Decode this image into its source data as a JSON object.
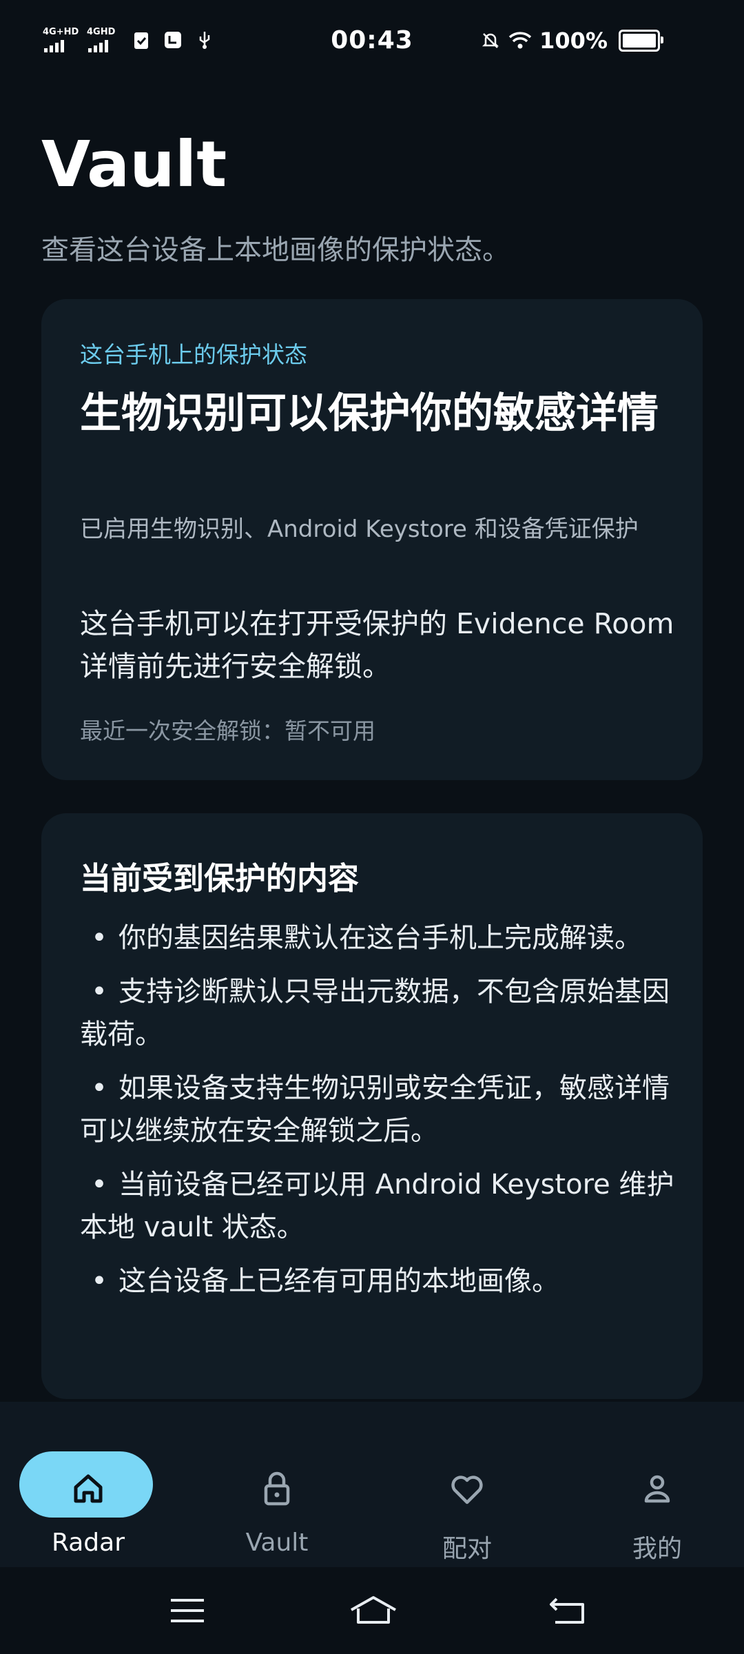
{
  "status_bar": {
    "net1": "4G+HD",
    "net2": "4GHD",
    "time": "00:43",
    "battery": "100%"
  },
  "header": {
    "title": "Vault",
    "subtitle": "查看这台设备上本地画像的保护状态。"
  },
  "status_card": {
    "eyebrow": "这台手机上的保护状态",
    "headline": "生物识别可以保护你的敏感详情",
    "detail": "已启用生物识别、Android Keystore 和设备凭证保护",
    "body": "这台手机可以在打开受保护的 Evidence Room 详情前先进行安全解锁。",
    "last_unlock": "最近一次安全解锁：暂不可用"
  },
  "content_card": {
    "title": "当前受到保护的内容",
    "bullet_symbol": "•",
    "items": [
      "你的基因结果默认在这台手机上完成解读。",
      "支持诊断默认只导出元数据，不包含原始基因载荷。",
      "如果设备支持生物识别或安全凭证，敏感详情可以继续放在安全解锁之后。",
      "当前设备已经可以用 Android Keystore 维护本地 vault 状态。",
      "这台设备上已经有可用的本地画像。"
    ]
  },
  "bottom_nav": {
    "items": [
      {
        "label": "Radar",
        "icon": "home-icon",
        "active": true
      },
      {
        "label": "Vault",
        "icon": "lock-icon",
        "active": false
      },
      {
        "label": "配对",
        "icon": "heart-icon",
        "active": false
      },
      {
        "label": "我的",
        "icon": "person-icon",
        "active": false
      }
    ]
  },
  "system_nav": {
    "icons": [
      "menu-icon",
      "home-outline-icon",
      "back-icon"
    ]
  },
  "colors": {
    "background": "#0a1016",
    "card": "#111c25",
    "accent": "#7ad7f6",
    "eyebrow": "#6ccbec"
  }
}
